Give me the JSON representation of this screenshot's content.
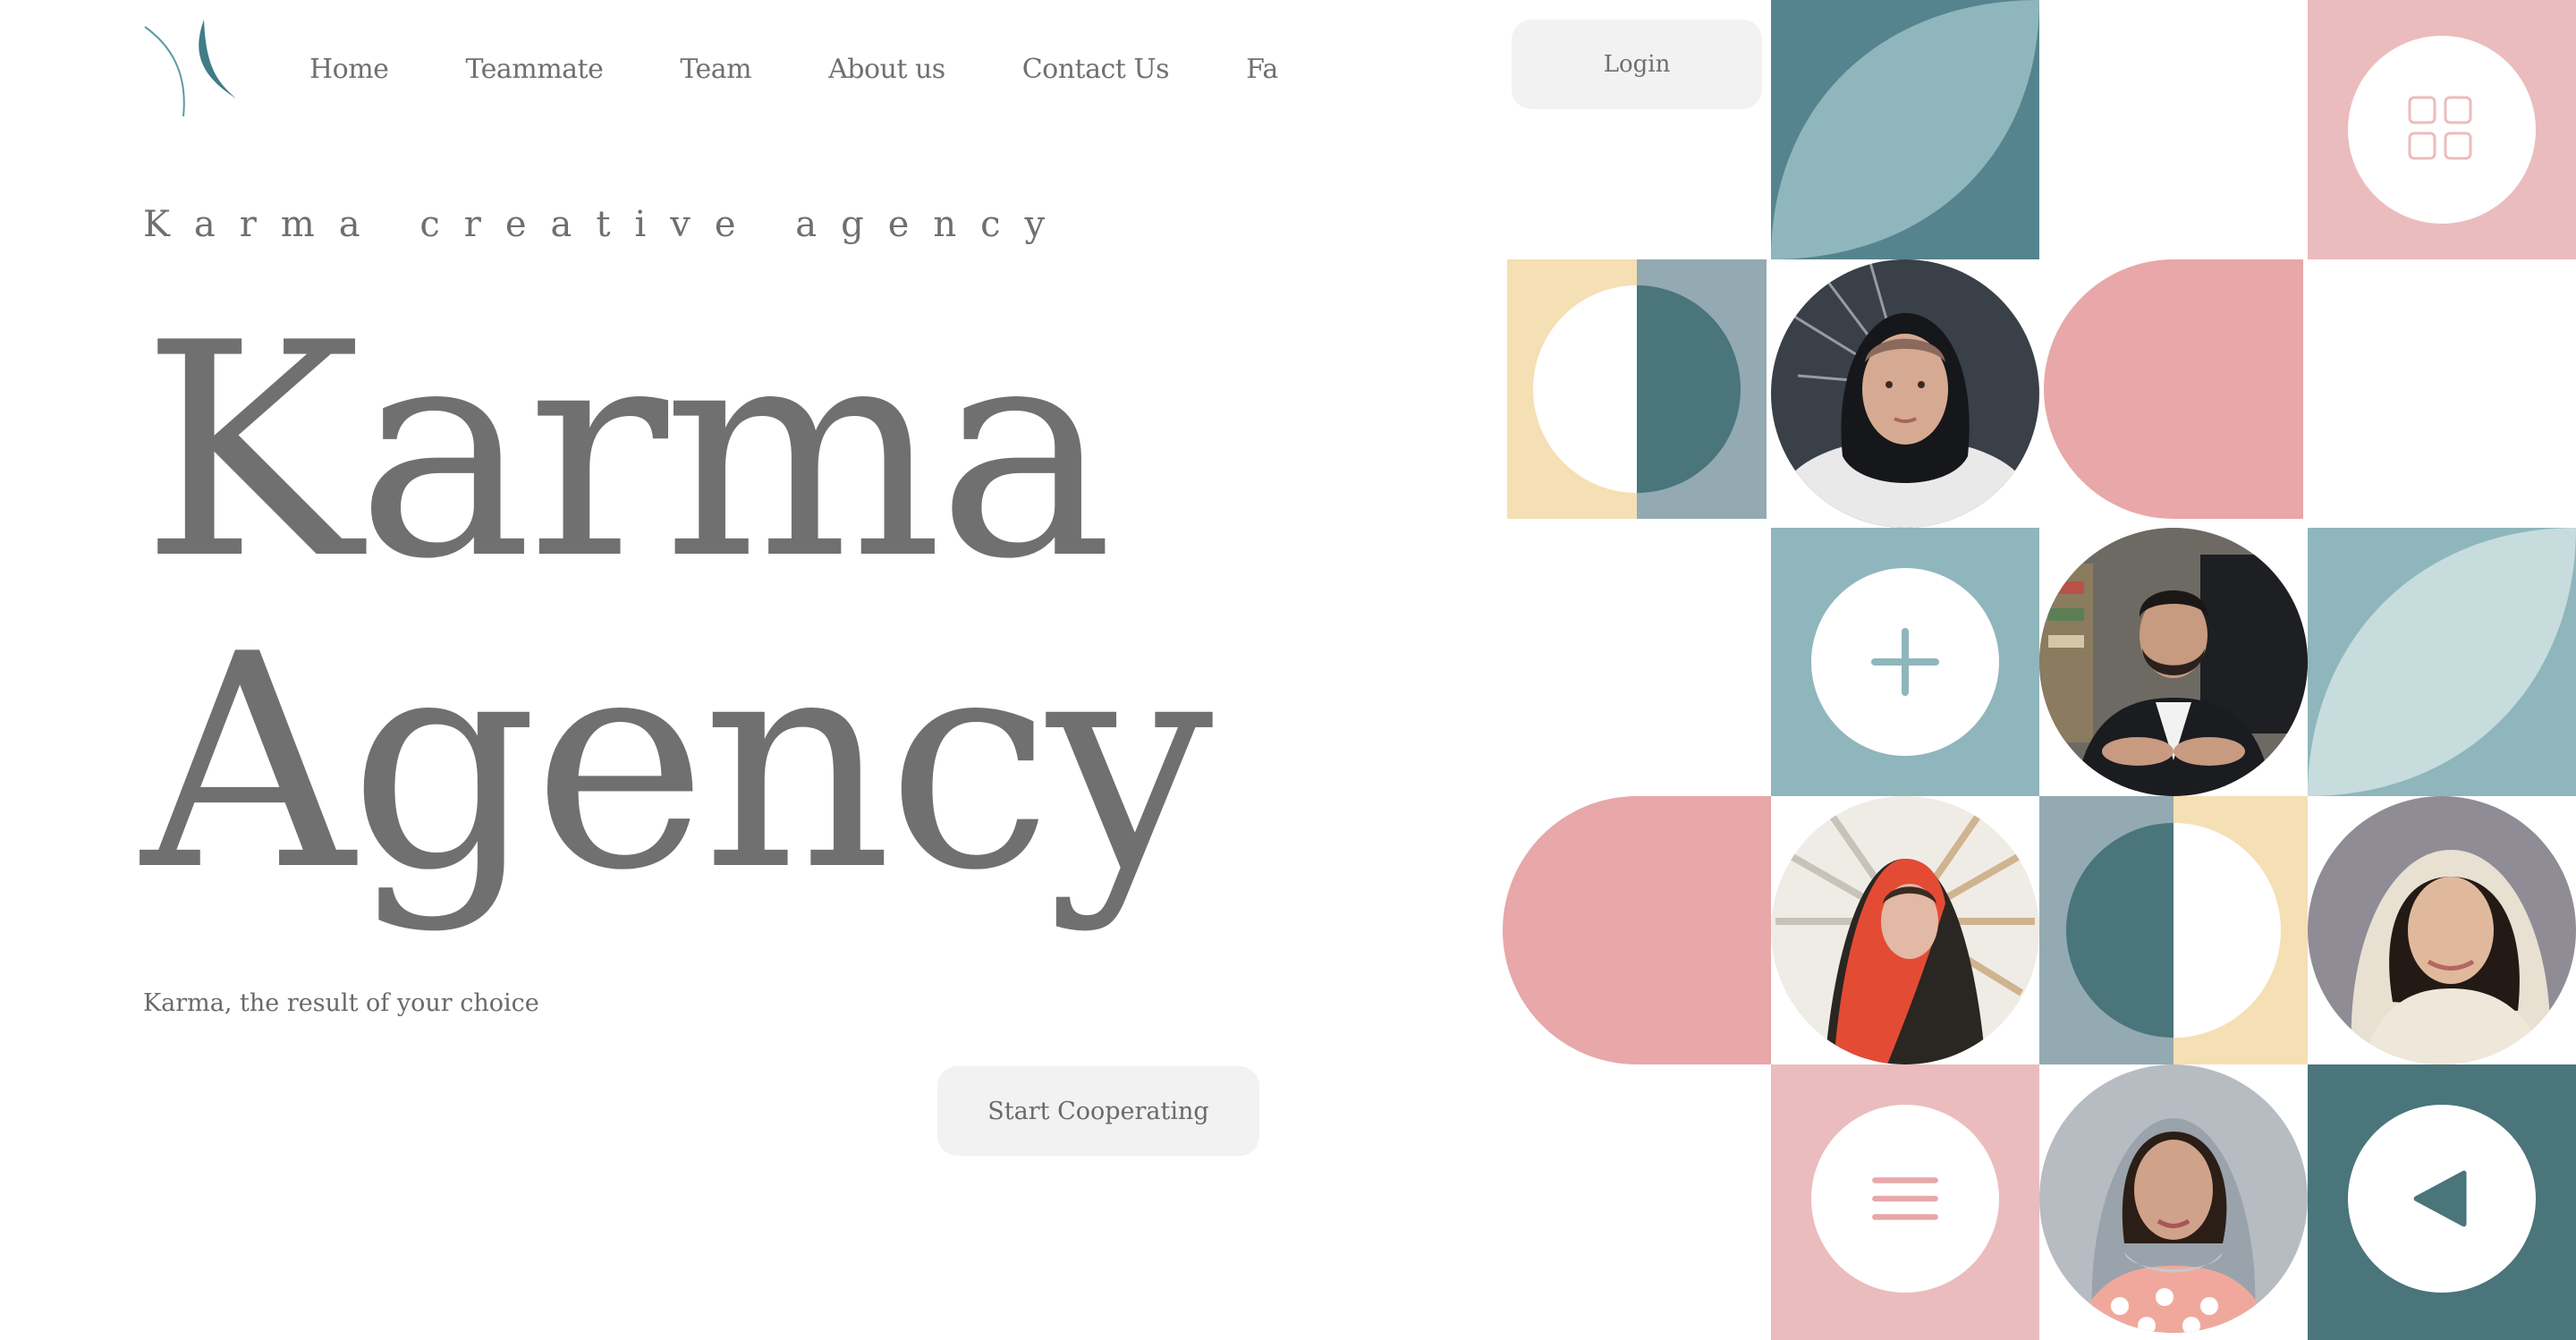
{
  "nav": {
    "items": [
      {
        "label": "Home"
      },
      {
        "label": "Teammate"
      },
      {
        "label": "Team"
      },
      {
        "label": "About us"
      },
      {
        "label": "Contact Us"
      },
      {
        "label": "Fa"
      }
    ],
    "login_label": "Login"
  },
  "hero": {
    "tagline": "Karma creative agency",
    "title_line1": "Karma",
    "title_line2": "Agency",
    "subtitle": "Karma, the result of your choice",
    "cta_label": "Start Cooperating"
  },
  "colors": {
    "teal_dark": "#55848e",
    "teal_deep": "#49757b",
    "teal_light": "#8fb6bc",
    "pink": "#e8a7a8",
    "pink_light": "#ebbcbd",
    "sand": "#f5dfb4",
    "slate": "#93aab3",
    "text": "#707070",
    "button_bg": "#f2f2f2"
  },
  "mosaic": {
    "icons": [
      "grid-icon",
      "plus-icon",
      "menu-icon",
      "play-back-icon"
    ],
    "photos": [
      "portrait-woman-black-scarf",
      "portrait-man-suit",
      "portrait-girl-red-scarf",
      "portrait-woman-white-scarf",
      "portrait-woman-grey-scarf"
    ]
  }
}
